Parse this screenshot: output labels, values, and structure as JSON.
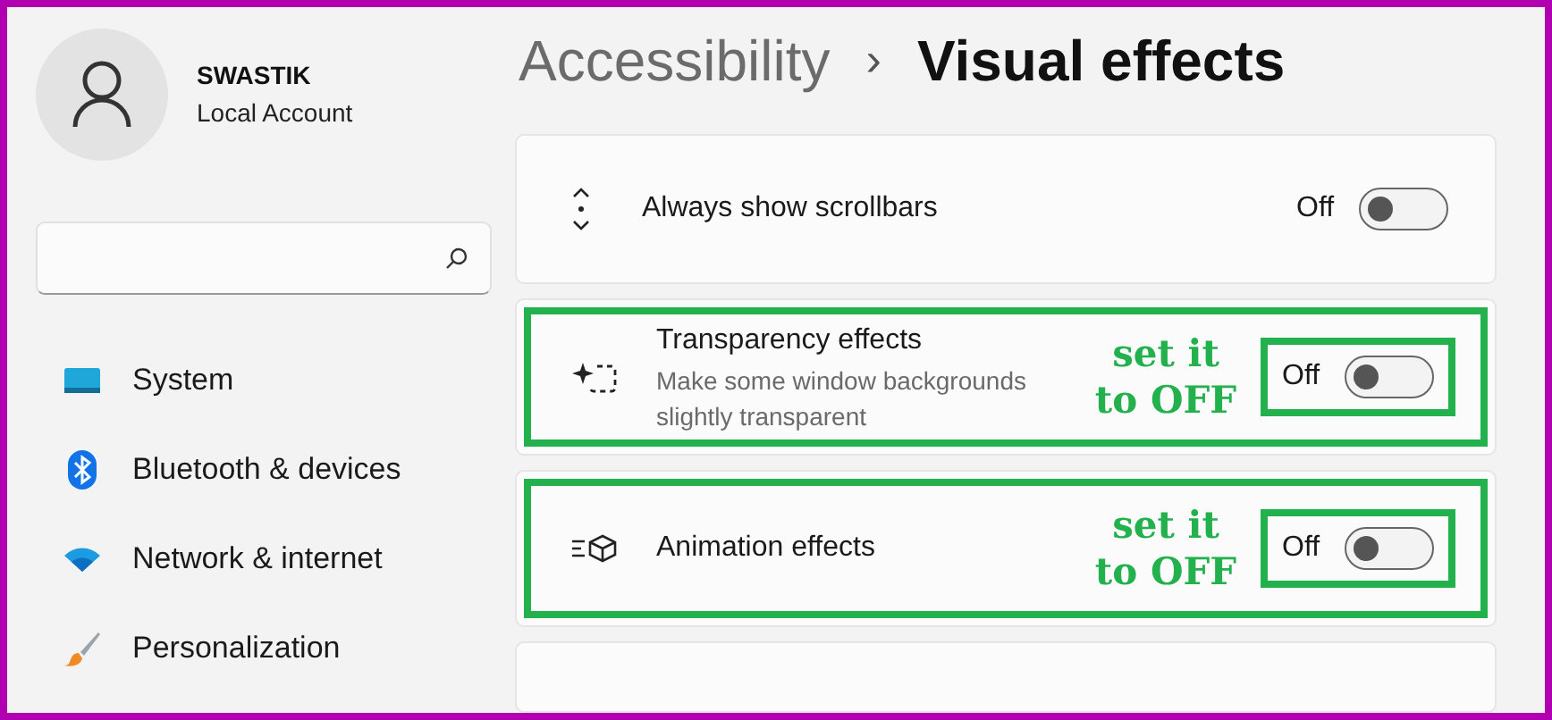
{
  "account": {
    "name": "SWASTIK",
    "type": "Local Account"
  },
  "nav": [
    {
      "kind": "system",
      "label": "System",
      "selected": false
    },
    {
      "kind": "bluetooth",
      "label": "Bluetooth & devices",
      "selected": false
    },
    {
      "kind": "network",
      "label": "Network & internet",
      "selected": false
    },
    {
      "kind": "personalization",
      "label": "Personalization",
      "selected": false
    }
  ],
  "breadcrumb": {
    "parent": "Accessibility",
    "separator": "›",
    "current": "Visual effects"
  },
  "settings": [
    {
      "kind": "scrollbars",
      "title": "Always show scrollbars",
      "state_label": "Off",
      "on": false,
      "highlighted": false
    },
    {
      "kind": "transparency",
      "title": "Transparency effects",
      "description": "Make some window backgrounds slightly transparent",
      "state_label": "Off",
      "on": false,
      "highlighted": true,
      "annotation": "set it to OFF"
    },
    {
      "kind": "animation",
      "title": "Animation effects",
      "state_label": "Off",
      "on": false,
      "highlighted": true,
      "annotation": "set it to OFF"
    }
  ]
}
